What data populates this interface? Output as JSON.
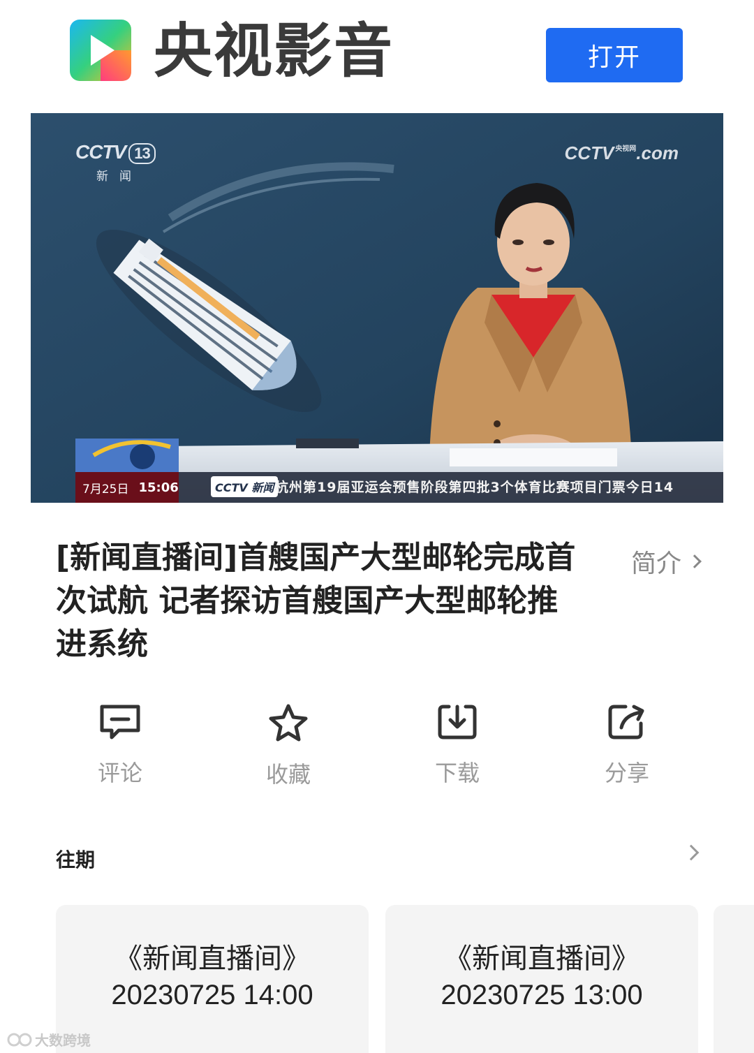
{
  "header": {
    "brand_name": "央视影音",
    "open_button": "打开"
  },
  "video": {
    "channel_logo": "CCTV",
    "channel_number": "13",
    "channel_sub": "新闻",
    "site_logo": "CCTV",
    "site_logo_small": "央视网",
    "site_domain": ".com",
    "ticker_date": "7月25日",
    "ticker_clock": "15:06",
    "ticker_logo": "CCTV 新闻",
    "ticker_text": "杭州第19届亚运会预售阶段第四批3个体育比赛项目门票今日14"
  },
  "title": {
    "text": "[新闻直播间]首艘国产大型邮轮完成首次试航 记者探访首艘国产大型邮轮推进系统",
    "intro_label": "简介"
  },
  "actions": [
    {
      "label": "评论",
      "icon": "comment-icon"
    },
    {
      "label": "收藏",
      "icon": "star-icon"
    },
    {
      "label": "下载",
      "icon": "download-icon"
    },
    {
      "label": "分享",
      "icon": "share-icon"
    }
  ],
  "past": {
    "section_title": "往期",
    "cards": [
      {
        "show": "《新闻直播间》",
        "date": "20230725 14:00"
      },
      {
        "show": "《新闻直播间》",
        "date": "20230725 13:00"
      }
    ]
  },
  "watermark": "大数跨境",
  "colors": {
    "accent": "#1f6bf2",
    "ticker_red": "#6a0f1a"
  }
}
